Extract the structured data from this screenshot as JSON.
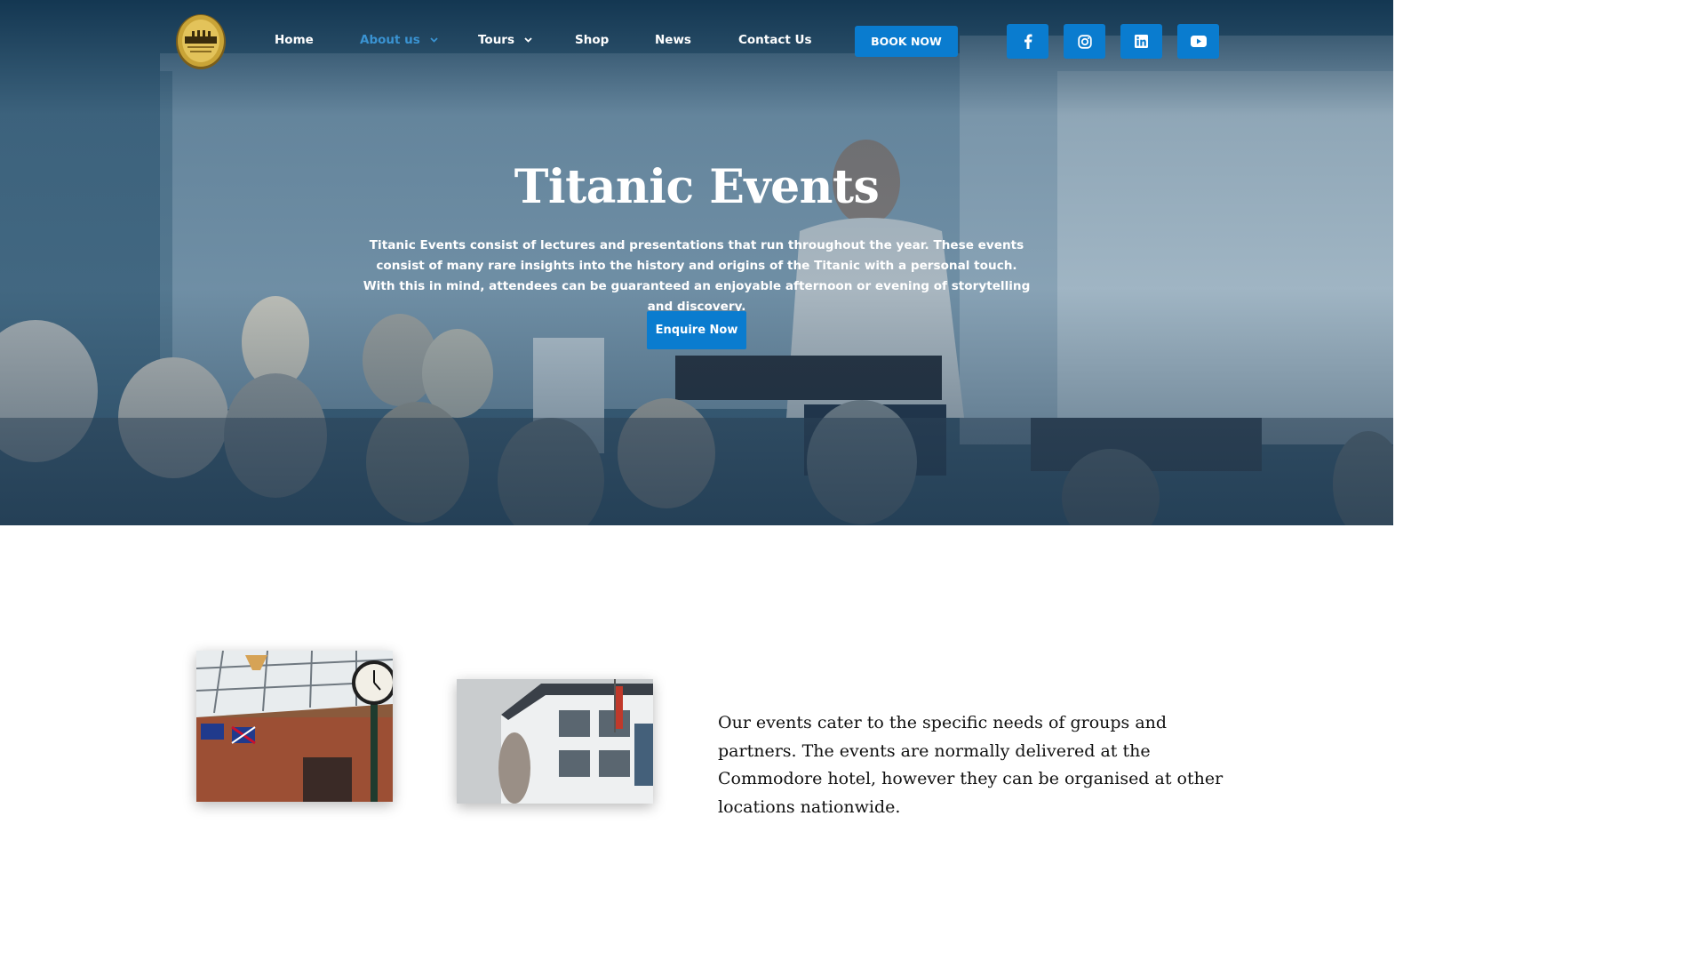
{
  "header": {
    "nav": [
      {
        "label": "Home",
        "active": false,
        "dropdown": false
      },
      {
        "label": "About us",
        "active": true,
        "dropdown": true
      },
      {
        "label": "Tours",
        "active": false,
        "dropdown": true
      },
      {
        "label": "Shop",
        "active": false,
        "dropdown": false
      },
      {
        "label": "News",
        "active": false,
        "dropdown": false
      },
      {
        "label": "Contact Us",
        "active": false,
        "dropdown": false
      }
    ],
    "book_label": "BOOK NOW",
    "social_icons": [
      "facebook-icon",
      "instagram-icon",
      "linkedin-icon",
      "youtube-icon"
    ]
  },
  "hero": {
    "title": "Titanic Events",
    "description": "Titanic Events consist of lectures and presentations that run throughout the year. These events consist of many rare insights into the history and origins of the Titanic with a personal touch. With this in mind, attendees can be guaranteed an enjoyable afternoon or evening of storytelling and discovery.",
    "cta_label": "Enquire Now"
  },
  "content": {
    "paragraph": "Our events cater to the specific needs of groups and partners. The events are normally delivered at the Commodore hotel, however they can be organised at other locations nationwide."
  },
  "colors": {
    "accent": "#0a7ccf",
    "active_nav": "#3a93d2",
    "hero_overlay": "#173a55",
    "body_text": "#111111"
  }
}
